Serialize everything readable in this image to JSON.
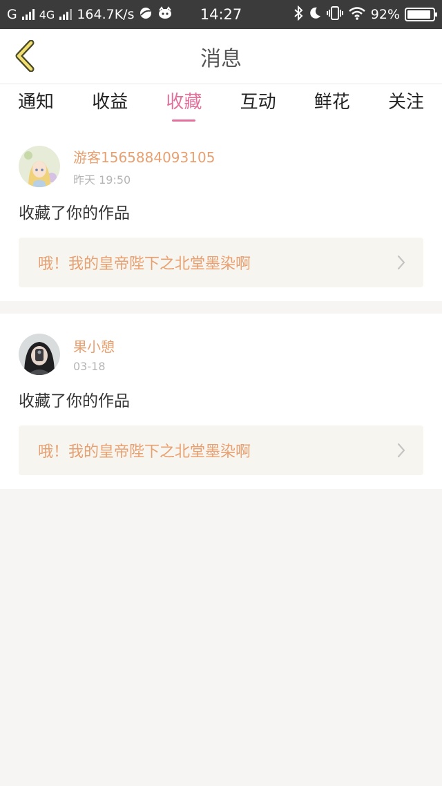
{
  "status_bar": {
    "carrier": "G",
    "network": "4G",
    "speed": "164.7K/s",
    "time": "14:27",
    "battery": "92%",
    "battery_level": 0.92
  },
  "header": {
    "title": "消息"
  },
  "tabs": [
    {
      "label": "通知",
      "active": false
    },
    {
      "label": "收益",
      "active": false
    },
    {
      "label": "收藏",
      "active": true
    },
    {
      "label": "互动",
      "active": false
    },
    {
      "label": "鲜花",
      "active": false
    },
    {
      "label": "关注",
      "active": false
    }
  ],
  "messages": [
    {
      "username": "游客1565884093105",
      "time": "昨天 19:50",
      "action": "收藏了你的作品",
      "work_title": "哦！我的皇帝陛下之北堂墨染啊"
    },
    {
      "username": "果小憩",
      "time": "03-18",
      "action": "收藏了你的作品",
      "work_title": "哦！我的皇帝陛下之北堂墨染啊"
    }
  ],
  "colors": {
    "accent": "#e3709a",
    "username": "#e8a071",
    "link_background": "#f6f5ef",
    "page_background": "#f7f4f4"
  }
}
